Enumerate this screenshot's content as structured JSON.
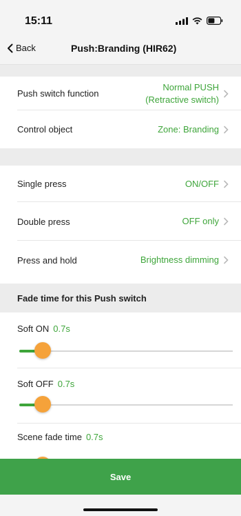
{
  "status": {
    "time": "15:11"
  },
  "nav": {
    "back_label": "Back",
    "title": "Push:Branding (HIR62)"
  },
  "rows": {
    "push_switch_function": {
      "label": "Push switch function",
      "value_line1": "Normal PUSH",
      "value_line2": "(Retractive switch)"
    },
    "control_object": {
      "label": "Control object",
      "value": "Zone: Branding"
    },
    "single_press": {
      "label": "Single press",
      "value": "ON/OFF"
    },
    "double_press": {
      "label": "Double press",
      "value": "OFF only"
    },
    "press_and_hold": {
      "label": "Press and hold",
      "value": "Brightness dimming"
    }
  },
  "fade_section": {
    "header": "Fade time for this Push switch",
    "sliders": [
      {
        "label": "Soft ON",
        "value": "0.7s",
        "level": 0.07
      },
      {
        "label": "Soft OFF",
        "value": "0.7s",
        "level": 0.07
      },
      {
        "label": "Scene fade time",
        "value": "0.7s",
        "level": 0.07
      }
    ]
  },
  "actions": {
    "save_label": "Save"
  },
  "colors": {
    "accent_green": "#3ea53a",
    "save_green": "#3fa24a",
    "thumb_orange": "#f5a23a"
  },
  "icons": [
    "signal-icon",
    "wifi-icon",
    "battery-icon",
    "back-chevron-icon",
    "chevron-right-icon"
  ]
}
